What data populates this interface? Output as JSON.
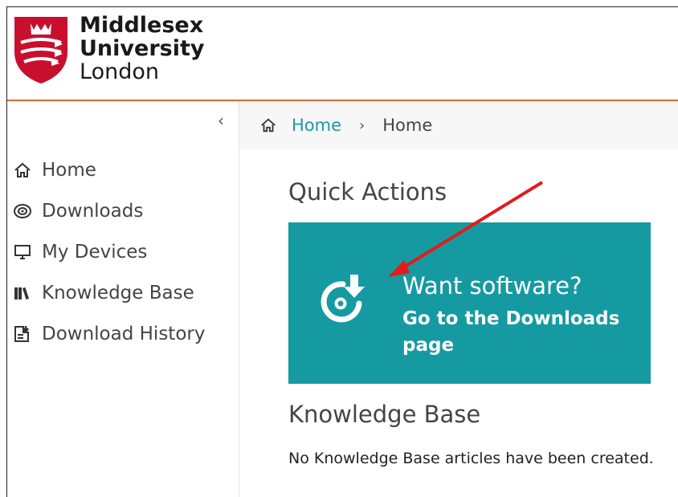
{
  "header": {
    "logo": {
      "line1": "Middlesex",
      "line2": "University",
      "line3": "London"
    }
  },
  "sidebar": {
    "collapse_icon": "chevron-left-icon",
    "items": [
      {
        "label": "Home",
        "icon": "home-icon"
      },
      {
        "label": "Downloads",
        "icon": "disc-icon"
      },
      {
        "label": "My Devices",
        "icon": "monitor-icon"
      },
      {
        "label": "Knowledge Base",
        "icon": "books-icon"
      },
      {
        "label": "Download History",
        "icon": "download-history-icon"
      }
    ]
  },
  "breadcrumb": {
    "home_link": "Home",
    "separator": "›",
    "current": "Home"
  },
  "main": {
    "quick_actions_title": "Quick Actions",
    "tile": {
      "heading": "Want software?",
      "subtext": "Go to the Downloads page",
      "icon": "disc-download-icon"
    },
    "knowledge_base_title": "Knowledge Base",
    "knowledge_base_empty": "No Knowledge Base articles have been created."
  },
  "colors": {
    "accent": "#e2643a",
    "tile": "#169aa1",
    "link": "#1f9aa3",
    "crest": "#c8102e",
    "annotation_arrow": "#e31b1b"
  }
}
